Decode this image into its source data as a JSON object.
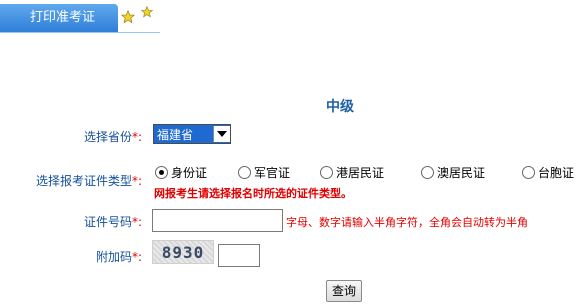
{
  "tab": {
    "label": "打印准考证"
  },
  "heading": "中级",
  "form": {
    "province": {
      "label": "选择省份",
      "required_mark": "*:",
      "selected": "福建省"
    },
    "id_type": {
      "label": "选择报考证件类型",
      "required_mark": "*:",
      "options": [
        "身份证",
        "军官证",
        "港居民证",
        "澳居民证",
        "台胞证"
      ],
      "selected_index": 0,
      "warning": "网报考生请选择报名时所选的证件类型。"
    },
    "id_number": {
      "label": "证件号码",
      "required_mark": "*:",
      "value": "",
      "hint": "字母、数字请输入半角字符，全角会自动转为半角"
    },
    "captcha": {
      "label": "附加码",
      "required_mark": "*:",
      "image_text": "8930",
      "value": ""
    },
    "submit_label": "查询"
  },
  "colors": {
    "accent": "#2f7fd8",
    "label": "#14509a",
    "required": "#e00000",
    "heading": "#1f5fa8"
  }
}
